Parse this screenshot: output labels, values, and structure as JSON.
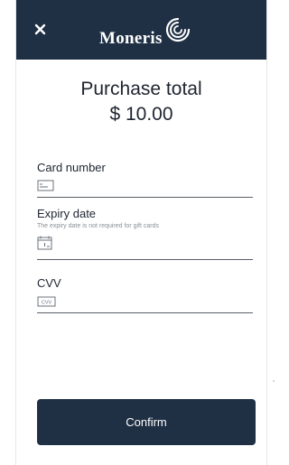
{
  "header": {
    "close_icon": "close-icon",
    "brand_name": "Moneris",
    "brand_logo_icon": "moneris-swirl-logo",
    "background_color": "#1f2f44"
  },
  "summary": {
    "title": "Purchase total",
    "amount": "$ 10.00"
  },
  "form": {
    "card_number": {
      "label": "Card number",
      "icon": "card-icon",
      "value": ""
    },
    "expiry_date": {
      "label": "Expiry date",
      "hint": "The expiry date is not required for gift cards",
      "icon": "calendar-icon",
      "value": ""
    },
    "cvv": {
      "label": "CVV",
      "icon": "cvv-icon",
      "icon_text": "CVV",
      "value": ""
    }
  },
  "actions": {
    "confirm_label": "Confirm",
    "confirm_color": "#1f2f44"
  }
}
